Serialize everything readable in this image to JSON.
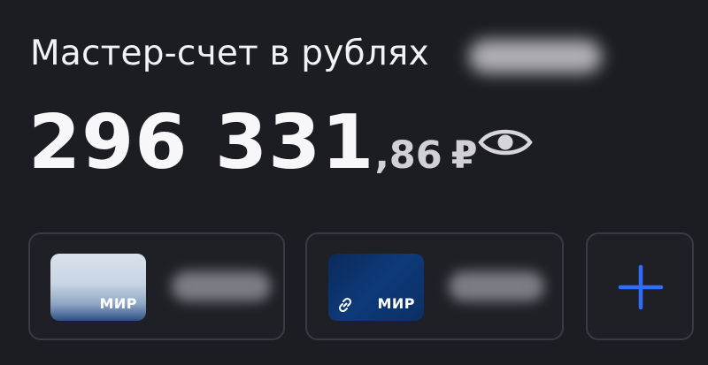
{
  "account": {
    "title": "Мастер-счет в рублях"
  },
  "balance": {
    "integer_part": "296 331",
    "fraction_part": ",86",
    "currency": "₽"
  },
  "icons": {
    "visibility": "eye-icon",
    "link": "link-icon",
    "add": "plus-icon"
  },
  "cards": [
    {
      "brand": "МИР",
      "linked": false
    },
    {
      "brand": "МИР",
      "linked": true
    }
  ],
  "colors": {
    "background": "#1c1d22",
    "tile_border": "#3a3b42",
    "accent": "#2f6dff",
    "text": "#f4f4f6"
  }
}
